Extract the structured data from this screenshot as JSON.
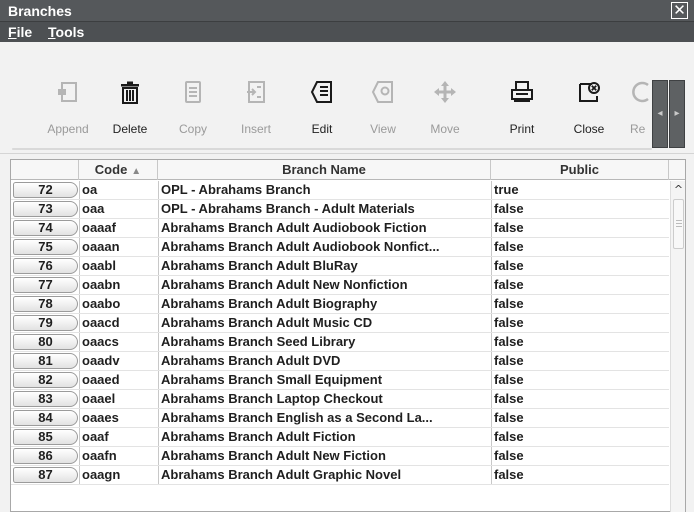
{
  "window": {
    "title": "Branches",
    "close_glyph": "✕"
  },
  "menu": {
    "items": [
      {
        "label": "File",
        "accel": "F",
        "rest": "ile"
      },
      {
        "label": "Tools",
        "accel": "T",
        "rest": "ools"
      }
    ]
  },
  "toolbar": {
    "buttons": [
      {
        "label": "Append",
        "icon": "append-icon",
        "enabled": false
      },
      {
        "label": "Delete",
        "icon": "trash-icon",
        "enabled": true
      },
      {
        "label": "Copy",
        "icon": "copy-icon",
        "enabled": false
      },
      {
        "label": "Insert",
        "icon": "insert-icon",
        "enabled": false
      },
      {
        "label": "Edit",
        "icon": "edit-icon",
        "enabled": true
      },
      {
        "label": "View",
        "icon": "view-icon",
        "enabled": false
      },
      {
        "label": "Move",
        "icon": "move-icon",
        "enabled": false
      },
      {
        "label": "Print",
        "icon": "print-icon",
        "enabled": true
      },
      {
        "label": "Close",
        "icon": "close-doc-icon",
        "enabled": true
      },
      {
        "label": "Re",
        "icon": "refresh-icon",
        "enabled": false
      }
    ]
  },
  "table": {
    "columns": {
      "code": "Code",
      "branch_name": "Branch Name",
      "public": "Public"
    },
    "sort_indicator": "▲",
    "rows": [
      {
        "num": "72",
        "code": "oa",
        "name": "OPL - Abrahams Branch",
        "public": "true"
      },
      {
        "num": "73",
        "code": "oaa",
        "name": "OPL - Abrahams Branch - Adult Materials",
        "public": "false"
      },
      {
        "num": "74",
        "code": "oaaaf",
        "name": "Abrahams Branch Adult Audiobook Fiction",
        "public": "false"
      },
      {
        "num": "75",
        "code": "oaaan",
        "name": "Abrahams Branch Adult Audiobook Nonfict...",
        "public": "false"
      },
      {
        "num": "76",
        "code": "oaabl",
        "name": "Abrahams Branch Adult BluRay",
        "public": "false"
      },
      {
        "num": "77",
        "code": "oaabn",
        "name": "Abrahams Branch Adult New Nonfiction",
        "public": "false"
      },
      {
        "num": "78",
        "code": "oaabo",
        "name": "Abrahams Branch Adult Biography",
        "public": "false"
      },
      {
        "num": "79",
        "code": "oaacd",
        "name": "Abrahams Branch Adult Music CD",
        "public": "false"
      },
      {
        "num": "80",
        "code": "oaacs",
        "name": "Abrahams Branch Seed Library",
        "public": "false"
      },
      {
        "num": "81",
        "code": "oaadv",
        "name": "Abrahams Branch Adult DVD",
        "public": "false"
      },
      {
        "num": "82",
        "code": "oaaed",
        "name": "Abrahams Branch Small Equipment",
        "public": "false"
      },
      {
        "num": "83",
        "code": "oaael",
        "name": "Abrahams Branch Laptop Checkout",
        "public": "false"
      },
      {
        "num": "84",
        "code": "oaaes",
        "name": "Abrahams Branch English as a Second La...",
        "public": "false"
      },
      {
        "num": "85",
        "code": "oaaf",
        "name": "Abrahams Branch Adult Fiction",
        "public": "false"
      },
      {
        "num": "86",
        "code": "oaafn",
        "name": "Abrahams Branch Adult New Fiction",
        "public": "false"
      },
      {
        "num": "87",
        "code": "oaagn",
        "name": "Abrahams Branch Adult Graphic Novel",
        "public": "false"
      }
    ]
  },
  "colors": {
    "titlebar": "#55585b",
    "enabled_label": "#222222",
    "disabled_label": "#9a9a9a"
  }
}
